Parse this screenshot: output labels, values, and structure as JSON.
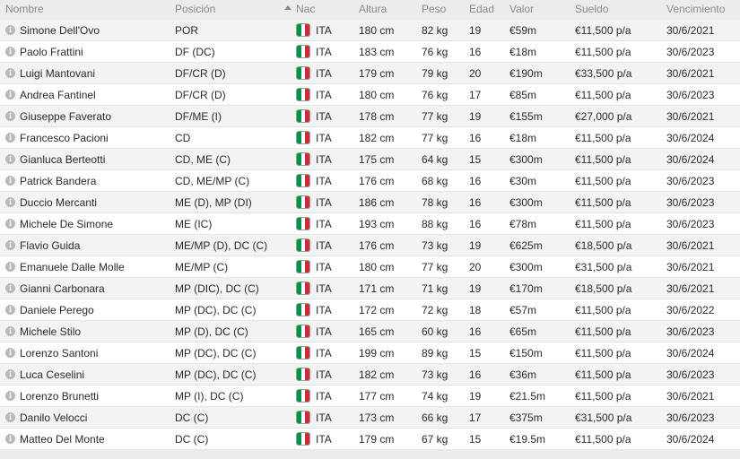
{
  "columns": {
    "nombre": "Nombre",
    "posicion": "Posición",
    "nac": "Nac",
    "altura": "Altura",
    "peso": "Peso",
    "edad": "Edad",
    "valor": "Valor",
    "sueldo": "Sueldo",
    "vencimiento": "Vencimiento"
  },
  "flag_colors": {
    "green": "#009246",
    "white": "#ffffff",
    "red": "#ce2b37"
  },
  "players": [
    {
      "nombre": "Simone Dell'Ovo",
      "posicion": "POR",
      "nac": "ITA",
      "altura": "180 cm",
      "peso": "82 kg",
      "edad": "19",
      "valor": "€59m",
      "sueldo": "€11,500 p/a",
      "vencimiento": "30/6/2021"
    },
    {
      "nombre": "Paolo Frattini",
      "posicion": "DF (DC)",
      "nac": "ITA",
      "altura": "183 cm",
      "peso": "76 kg",
      "edad": "16",
      "valor": "€18m",
      "sueldo": "€11,500 p/a",
      "vencimiento": "30/6/2023"
    },
    {
      "nombre": "Luigi Mantovani",
      "posicion": "DF/CR (D)",
      "nac": "ITA",
      "altura": "179 cm",
      "peso": "79 kg",
      "edad": "20",
      "valor": "€190m",
      "sueldo": "€33,500 p/a",
      "vencimiento": "30/6/2021"
    },
    {
      "nombre": "Andrea Fantinel",
      "posicion": "DF/CR (D)",
      "nac": "ITA",
      "altura": "180 cm",
      "peso": "76 kg",
      "edad": "17",
      "valor": "€85m",
      "sueldo": "€11,500 p/a",
      "vencimiento": "30/6/2023"
    },
    {
      "nombre": "Giuseppe Faverato",
      "posicion": "DF/ME (I)",
      "nac": "ITA",
      "altura": "178 cm",
      "peso": "77 kg",
      "edad": "19",
      "valor": "€155m",
      "sueldo": "€27,000 p/a",
      "vencimiento": "30/6/2021"
    },
    {
      "nombre": "Francesco Pacioni",
      "posicion": "CD",
      "nac": "ITA",
      "altura": "182 cm",
      "peso": "77 kg",
      "edad": "16",
      "valor": "€18m",
      "sueldo": "€11,500 p/a",
      "vencimiento": "30/6/2024"
    },
    {
      "nombre": "Gianluca Berteotti",
      "posicion": "CD, ME (C)",
      "nac": "ITA",
      "altura": "175 cm",
      "peso": "64 kg",
      "edad": "15",
      "valor": "€300m",
      "sueldo": "€11,500 p/a",
      "vencimiento": "30/6/2024"
    },
    {
      "nombre": "Patrick Bandera",
      "posicion": "CD, ME/MP (C)",
      "nac": "ITA",
      "altura": "176 cm",
      "peso": "68 kg",
      "edad": "16",
      "valor": "€30m",
      "sueldo": "€11,500 p/a",
      "vencimiento": "30/6/2023"
    },
    {
      "nombre": "Duccio Mercanti",
      "posicion": "ME (D), MP (DI)",
      "nac": "ITA",
      "altura": "186 cm",
      "peso": "78 kg",
      "edad": "16",
      "valor": "€300m",
      "sueldo": "€11,500 p/a",
      "vencimiento": "30/6/2023"
    },
    {
      "nombre": "Michele De Simone",
      "posicion": "ME (IC)",
      "nac": "ITA",
      "altura": "193 cm",
      "peso": "88 kg",
      "edad": "16",
      "valor": "€78m",
      "sueldo": "€11,500 p/a",
      "vencimiento": "30/6/2023"
    },
    {
      "nombre": "Flavio Guida",
      "posicion": "ME/MP (D), DC (C)",
      "nac": "ITA",
      "altura": "176 cm",
      "peso": "73 kg",
      "edad": "19",
      "valor": "€625m",
      "sueldo": "€18,500 p/a",
      "vencimiento": "30/6/2021"
    },
    {
      "nombre": "Emanuele Dalle Molle",
      "posicion": "ME/MP (C)",
      "nac": "ITA",
      "altura": "180 cm",
      "peso": "77 kg",
      "edad": "20",
      "valor": "€300m",
      "sueldo": "€31,500 p/a",
      "vencimiento": "30/6/2021"
    },
    {
      "nombre": "Gianni Carbonara",
      "posicion": "MP (DIC), DC (C)",
      "nac": "ITA",
      "altura": "171 cm",
      "peso": "71 kg",
      "edad": "19",
      "valor": "€170m",
      "sueldo": "€18,500 p/a",
      "vencimiento": "30/6/2021"
    },
    {
      "nombre": "Daniele Perego",
      "posicion": "MP (DC), DC (C)",
      "nac": "ITA",
      "altura": "172 cm",
      "peso": "72 kg",
      "edad": "18",
      "valor": "€57m",
      "sueldo": "€11,500 p/a",
      "vencimiento": "30/6/2022"
    },
    {
      "nombre": "Michele Stilo",
      "posicion": "MP (D), DC (C)",
      "nac": "ITA",
      "altura": "165 cm",
      "peso": "60 kg",
      "edad": "16",
      "valor": "€65m",
      "sueldo": "€11,500 p/a",
      "vencimiento": "30/6/2023"
    },
    {
      "nombre": "Lorenzo Santoni",
      "posicion": "MP (DC), DC (C)",
      "nac": "ITA",
      "altura": "199 cm",
      "peso": "89 kg",
      "edad": "15",
      "valor": "€150m",
      "sueldo": "€11,500 p/a",
      "vencimiento": "30/6/2024"
    },
    {
      "nombre": "Luca Ceselini",
      "posicion": "MP (DC), DC (C)",
      "nac": "ITA",
      "altura": "182 cm",
      "peso": "73 kg",
      "edad": "16",
      "valor": "€36m",
      "sueldo": "€11,500 p/a",
      "vencimiento": "30/6/2023"
    },
    {
      "nombre": "Lorenzo Brunetti",
      "posicion": "MP (I), DC (C)",
      "nac": "ITA",
      "altura": "177 cm",
      "peso": "74 kg",
      "edad": "19",
      "valor": "€21.5m",
      "sueldo": "€11,500 p/a",
      "vencimiento": "30/6/2021"
    },
    {
      "nombre": "Danilo Velocci",
      "posicion": "DC (C)",
      "nac": "ITA",
      "altura": "173 cm",
      "peso": "66 kg",
      "edad": "17",
      "valor": "€375m",
      "sueldo": "€31,500 p/a",
      "vencimiento": "30/6/2023"
    },
    {
      "nombre": "Matteo Del Monte",
      "posicion": "DC (C)",
      "nac": "ITA",
      "altura": "179 cm",
      "peso": "67 kg",
      "edad": "15",
      "valor": "€19.5m",
      "sueldo": "€11,500 p/a",
      "vencimiento": "30/6/2024"
    }
  ]
}
